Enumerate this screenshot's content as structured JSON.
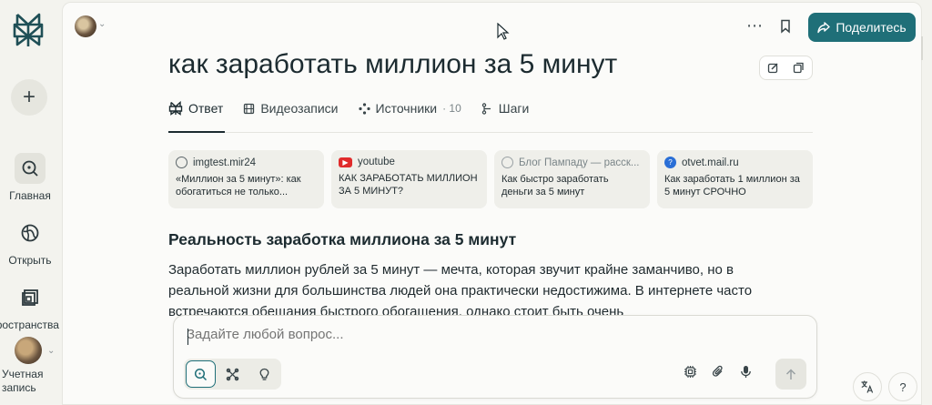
{
  "rail": {
    "items": [
      {
        "label": "Главная",
        "icon": "search-icon",
        "active": true
      },
      {
        "label": "Открыть",
        "icon": "globe-icon",
        "active": false
      },
      {
        "label": "Пространства",
        "icon": "spaces-icon",
        "active": false
      }
    ],
    "account_label_line1": "Учетная",
    "account_label_line2": "запись"
  },
  "header": {
    "share_label": "Поделитесь"
  },
  "thread": {
    "title": "как заработать миллион за 5 минут",
    "tabs": [
      {
        "label": "Ответ",
        "icon": "perplexity-icon"
      },
      {
        "label": "Видеозаписи",
        "icon": "film-icon"
      },
      {
        "label": "Источники",
        "icon": "sources-icon",
        "count": "· 10"
      },
      {
        "label": "Шаги",
        "icon": "steps-icon"
      }
    ]
  },
  "sources": [
    {
      "site": "imgtest.mir24",
      "text": "«Миллион за 5 минут»: как обогатиться не только...",
      "favicon_color": "#5b6569"
    },
    {
      "site": "youtube",
      "text": "КАК ЗАРАБОТАТЬ МИЛЛИОН ЗА 5 МИНУТ?",
      "favicon_color": "#e02b2b"
    },
    {
      "site": "Блог Пампаду — расск...",
      "text": "Как быстро заработать деньги за 5 минут",
      "favicon_color": "#9aa1a4"
    },
    {
      "site": "otvet.mail.ru",
      "text": "Как заработать 1 миллион за 5 минут СРОЧНО",
      "favicon_color": "#2a6fd6"
    }
  ],
  "answer": {
    "heading": "Реальность заработка миллиона за 5 минут",
    "paragraph": "Заработать миллион рублей за 5 минут — мечта, которая звучит крайне заманчиво, но в реальной жизни для большинства людей она практически недостижима. В интернете часто встречаются обещания быстрого обогащения, однако стоит быть очень"
  },
  "composer": {
    "placeholder": "Задайте любой вопрос..."
  },
  "colors": {
    "accent": "#1f6f78",
    "background": "#f3f3ee",
    "panel": "#fbfbf9"
  }
}
